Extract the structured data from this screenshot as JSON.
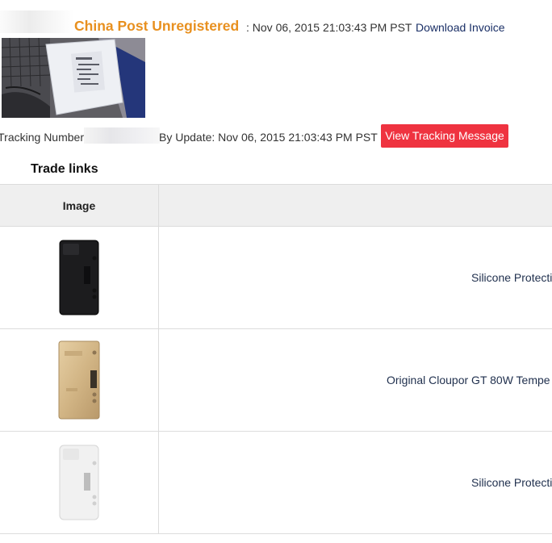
{
  "order": {
    "carrier": "China Post Unregistered",
    "ship_date": ": Nov 06, 2015 21:03:43 PM PST",
    "download_label": "Download Invoice"
  },
  "tracking": {
    "label": "Tracking Number:",
    "update_text": "By Update: Nov 06, 2015 21:03:43 PM PST",
    "button_label": "View Tracking Message"
  },
  "trade_links": {
    "title": "Trade links",
    "column_image": "Image",
    "items": [
      {
        "title": "Silicone Protecti",
        "product_color": "black"
      },
      {
        "title": "Original Cloupor GT 80W Tempe",
        "product_color": "gold"
      },
      {
        "title": "Silicone Protecti",
        "product_color": "white"
      }
    ]
  }
}
